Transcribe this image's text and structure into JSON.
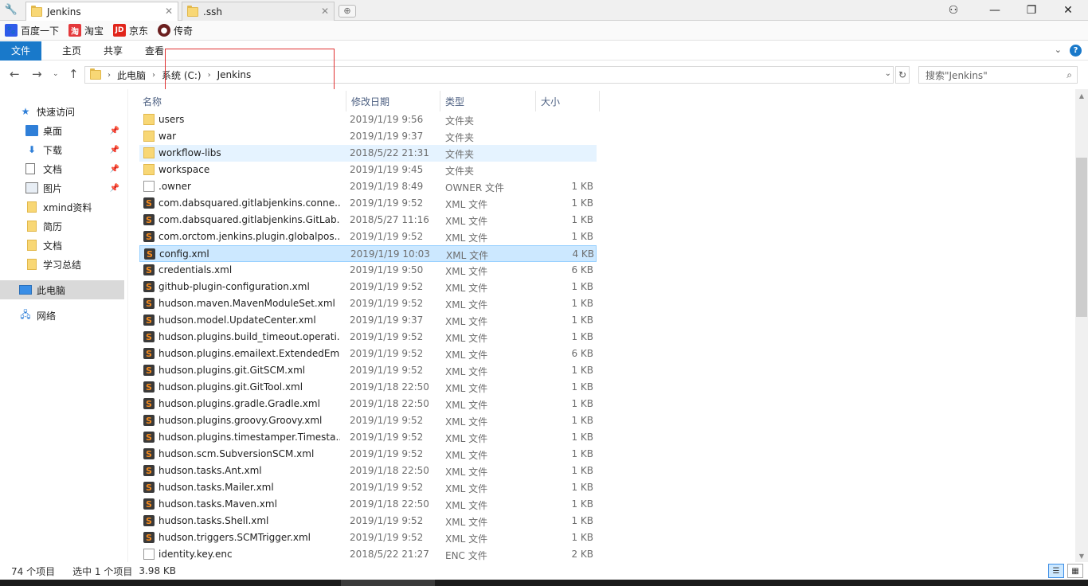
{
  "tabs": [
    {
      "label": "Jenkins",
      "active": true
    },
    {
      "label": ".ssh",
      "active": false
    }
  ],
  "bookmarks": [
    {
      "label": "百度一下",
      "color": "#2f5bea",
      "glyph": "🐾"
    },
    {
      "label": "淘宝",
      "color": "#e4393c",
      "glyph": "淘"
    },
    {
      "label": "京东",
      "color": "#e1251b",
      "glyph": "JD"
    },
    {
      "label": "传奇",
      "color": "#6b1f1f",
      "glyph": "●"
    }
  ],
  "ribbon": {
    "file": "文件",
    "home": "主页",
    "share": "共享",
    "view": "查看"
  },
  "address": {
    "this_pc": "此电脑",
    "drive": "系统 (C:)",
    "folder": "Jenkins"
  },
  "search": {
    "placeholder": "搜索\"Jenkins\""
  },
  "nav": {
    "quick_access": "快速访问",
    "desktop": "桌面",
    "downloads": "下载",
    "documents": "文档",
    "pictures": "图片",
    "xmind": "xmind资料",
    "resume": "简历",
    "docs2": "文档",
    "summary": "学习总结",
    "this_pc": "此电脑",
    "network": "网络"
  },
  "columns": {
    "name": "名称",
    "date": "修改日期",
    "type": "类型",
    "size": "大小"
  },
  "files": [
    {
      "name": "users",
      "date": "2019/1/19 9:56",
      "type": "文件夹",
      "size": "",
      "icon": "folder"
    },
    {
      "name": "war",
      "date": "2019/1/19 9:37",
      "type": "文件夹",
      "size": "",
      "icon": "folder"
    },
    {
      "name": "workflow-libs",
      "date": "2018/5/22 21:31",
      "type": "文件夹",
      "size": "",
      "icon": "folder",
      "state": "hover"
    },
    {
      "name": "workspace",
      "date": "2019/1/19 9:45",
      "type": "文件夹",
      "size": "",
      "icon": "folder"
    },
    {
      "name": ".owner",
      "date": "2019/1/19 8:49",
      "type": "OWNER 文件",
      "size": "1 KB",
      "icon": "doc"
    },
    {
      "name": "com.dabsquared.gitlabjenkins.conne...",
      "date": "2019/1/19 9:52",
      "type": "XML 文件",
      "size": "1 KB",
      "icon": "xml"
    },
    {
      "name": "com.dabsquared.gitlabjenkins.GitLab...",
      "date": "2018/5/27 11:16",
      "type": "XML 文件",
      "size": "1 KB",
      "icon": "xml"
    },
    {
      "name": "com.orctom.jenkins.plugin.globalpos...",
      "date": "2019/1/19 9:52",
      "type": "XML 文件",
      "size": "1 KB",
      "icon": "xml"
    },
    {
      "name": "config.xml",
      "date": "2019/1/19 10:03",
      "type": "XML 文件",
      "size": "4 KB",
      "icon": "xml",
      "state": "selected"
    },
    {
      "name": "credentials.xml",
      "date": "2019/1/19 9:50",
      "type": "XML 文件",
      "size": "6 KB",
      "icon": "xml"
    },
    {
      "name": "github-plugin-configuration.xml",
      "date": "2019/1/19 9:52",
      "type": "XML 文件",
      "size": "1 KB",
      "icon": "xml"
    },
    {
      "name": "hudson.maven.MavenModuleSet.xml",
      "date": "2019/1/19 9:52",
      "type": "XML 文件",
      "size": "1 KB",
      "icon": "xml"
    },
    {
      "name": "hudson.model.UpdateCenter.xml",
      "date": "2019/1/19 9:37",
      "type": "XML 文件",
      "size": "1 KB",
      "icon": "xml"
    },
    {
      "name": "hudson.plugins.build_timeout.operati...",
      "date": "2019/1/19 9:52",
      "type": "XML 文件",
      "size": "1 KB",
      "icon": "xml"
    },
    {
      "name": "hudson.plugins.emailext.ExtendedEm...",
      "date": "2019/1/19 9:52",
      "type": "XML 文件",
      "size": "6 KB",
      "icon": "xml"
    },
    {
      "name": "hudson.plugins.git.GitSCM.xml",
      "date": "2019/1/19 9:52",
      "type": "XML 文件",
      "size": "1 KB",
      "icon": "xml"
    },
    {
      "name": "hudson.plugins.git.GitTool.xml",
      "date": "2019/1/18 22:50",
      "type": "XML 文件",
      "size": "1 KB",
      "icon": "xml"
    },
    {
      "name": "hudson.plugins.gradle.Gradle.xml",
      "date": "2019/1/18 22:50",
      "type": "XML 文件",
      "size": "1 KB",
      "icon": "xml"
    },
    {
      "name": "hudson.plugins.groovy.Groovy.xml",
      "date": "2019/1/19 9:52",
      "type": "XML 文件",
      "size": "1 KB",
      "icon": "xml"
    },
    {
      "name": "hudson.plugins.timestamper.Timesta...",
      "date": "2019/1/19 9:52",
      "type": "XML 文件",
      "size": "1 KB",
      "icon": "xml"
    },
    {
      "name": "hudson.scm.SubversionSCM.xml",
      "date": "2019/1/19 9:52",
      "type": "XML 文件",
      "size": "1 KB",
      "icon": "xml"
    },
    {
      "name": "hudson.tasks.Ant.xml",
      "date": "2019/1/18 22:50",
      "type": "XML 文件",
      "size": "1 KB",
      "icon": "xml"
    },
    {
      "name": "hudson.tasks.Mailer.xml",
      "date": "2019/1/19 9:52",
      "type": "XML 文件",
      "size": "1 KB",
      "icon": "xml"
    },
    {
      "name": "hudson.tasks.Maven.xml",
      "date": "2019/1/18 22:50",
      "type": "XML 文件",
      "size": "1 KB",
      "icon": "xml"
    },
    {
      "name": "hudson.tasks.Shell.xml",
      "date": "2019/1/19 9:52",
      "type": "XML 文件",
      "size": "1 KB",
      "icon": "xml"
    },
    {
      "name": "hudson.triggers.SCMTrigger.xml",
      "date": "2019/1/19 9:52",
      "type": "XML 文件",
      "size": "1 KB",
      "icon": "xml"
    },
    {
      "name": "identity.key.enc",
      "date": "2018/5/22 21:27",
      "type": "ENC 文件",
      "size": "2 KB",
      "icon": "doc"
    }
  ],
  "status": {
    "count": "74 个项目",
    "selected": "选中 1 个项目",
    "size": "3.98 KB"
  }
}
